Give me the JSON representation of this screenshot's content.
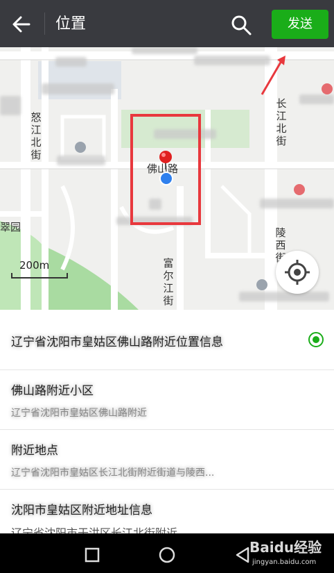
{
  "header": {
    "title": "位置",
    "send_label": "发送"
  },
  "map": {
    "street_labels": {
      "nujiang": "怒江北街",
      "changjiang": "长江北街",
      "foshan": "佛山路",
      "lingxi": "陵西街",
      "fuerjiang": "富尔江街",
      "cuiyuan": "翠园"
    },
    "scale_label": "200m"
  },
  "places": [
    {
      "name": "辽宁省沈阳市皇姑区佛山路附近位置信息",
      "address": "",
      "selected": true
    },
    {
      "name": "佛山路附近小区",
      "address": "辽宁省沈阳市皇姑区佛山路附近",
      "selected": false
    },
    {
      "name": "附近地点",
      "address": "辽宁省沈阳市皇姑区长江北街附近街道与陵西...",
      "selected": false
    },
    {
      "name": "沈阳市皇姑区附近地址信息",
      "address": "辽宁省沈阳市于洪区长江北街附近",
      "selected": false
    }
  ],
  "watermark": {
    "brand": "Baidu经验",
    "url": "jingyan.baidu.com"
  },
  "colors": {
    "topbar": "#393a3f",
    "send_button": "#1aad19",
    "highlight": "#e8383d"
  }
}
